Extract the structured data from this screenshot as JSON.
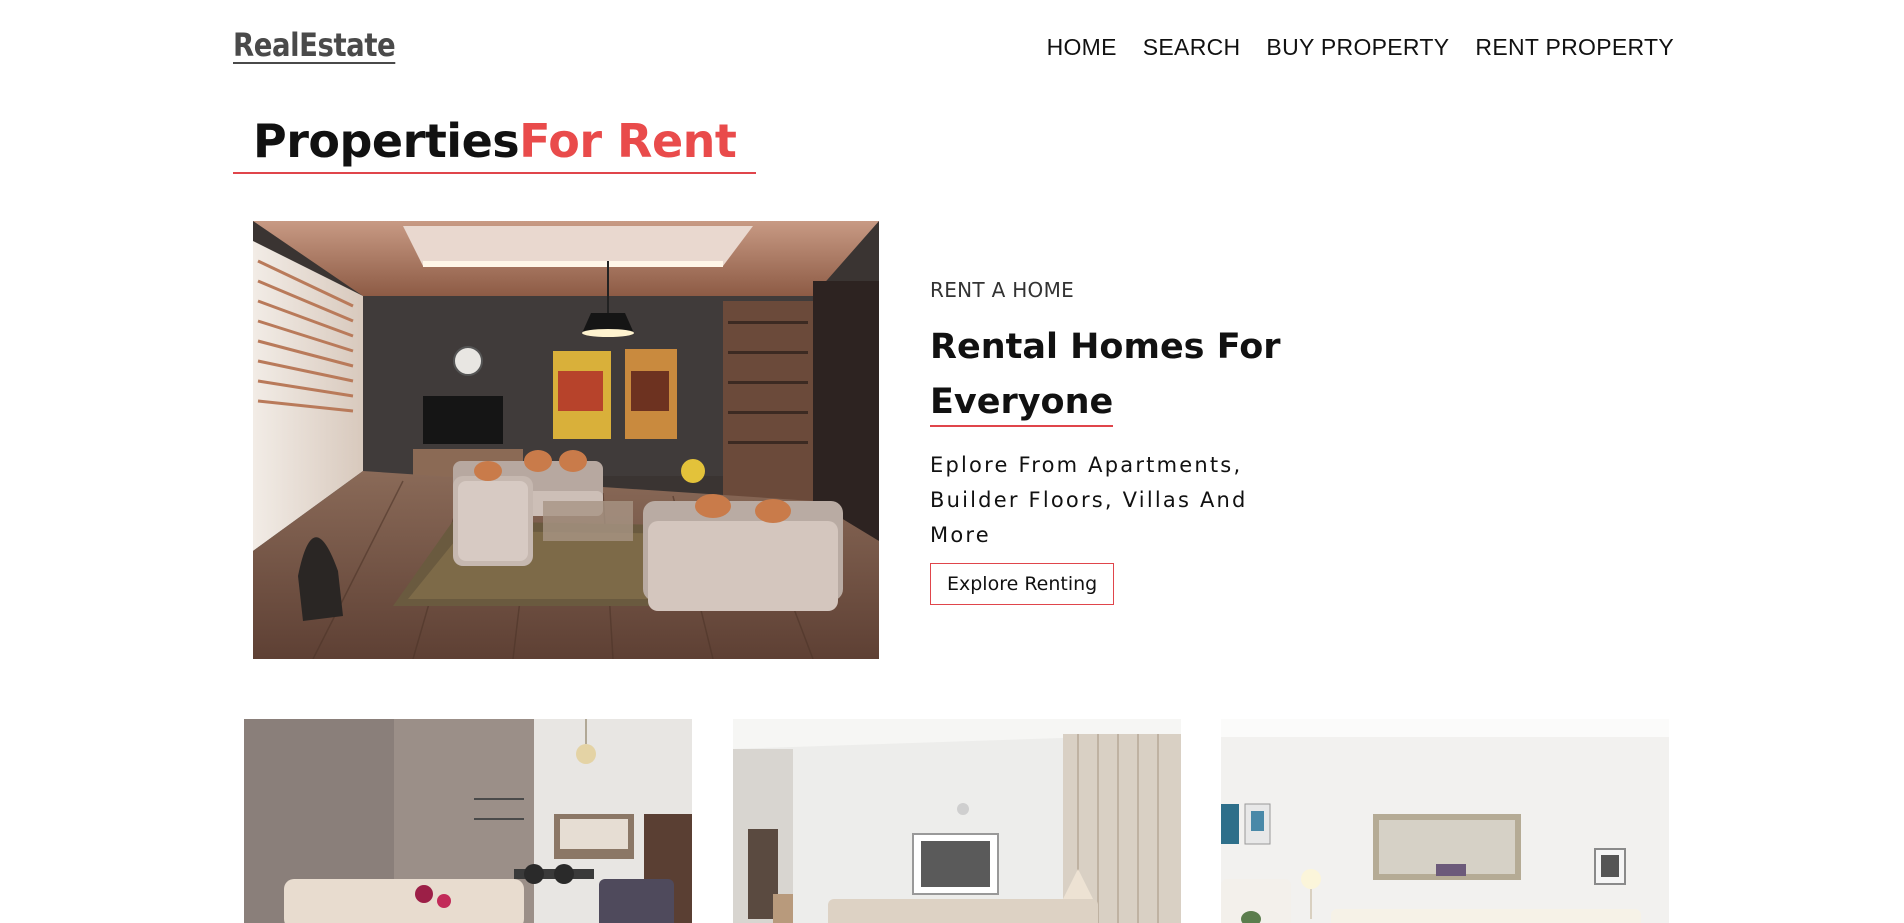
{
  "header": {
    "logo": "RealEstate",
    "nav": [
      "HOME",
      "SEARCH",
      "BUY PROPERTY",
      "RENT PROPERTY"
    ]
  },
  "section": {
    "title_dark": "Properties",
    "title_accent": "For Rent"
  },
  "hero": {
    "eyebrow": "RENT A HOME",
    "heading_line1": "Rental Homes For",
    "heading_line2": "Everyone",
    "description": "Eplore From Apartments, Builder Floors, Villas And More",
    "button": "Explore Renting"
  },
  "colors": {
    "accent": "#e94b4b",
    "text": "#111111",
    "logo": "#4a4a4a"
  }
}
